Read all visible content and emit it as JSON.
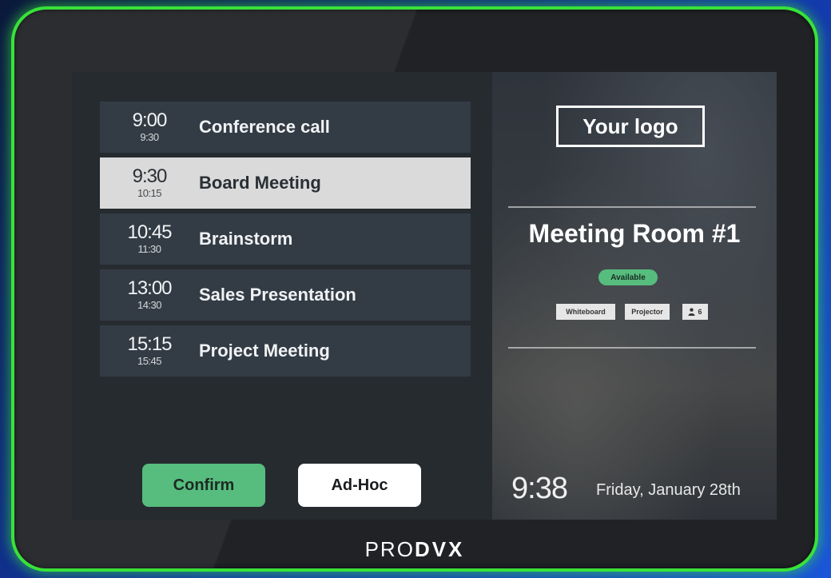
{
  "meetings": [
    {
      "start": "9:00",
      "end": "9:30",
      "title": "Conference call",
      "active": false
    },
    {
      "start": "9:30",
      "end": "10:15",
      "title": "Board Meeting",
      "active": true
    },
    {
      "start": "10:45",
      "end": "11:30",
      "title": "Brainstorm",
      "active": false
    },
    {
      "start": "13:00",
      "end": "14:30",
      "title": "Sales Presentation",
      "active": false
    },
    {
      "start": "15:15",
      "end": "15:45",
      "title": "Project Meeting",
      "active": false
    }
  ],
  "buttons": {
    "confirm": "Confirm",
    "adhoc": "Ad-Hoc"
  },
  "room": {
    "logo": "Your logo",
    "name": "Meeting Room #1",
    "status": "Available",
    "amenities": [
      "Whiteboard",
      "Projector"
    ],
    "capacity": "6"
  },
  "clock": {
    "time": "9:38",
    "date": "Friday, January 28th"
  },
  "brand": {
    "light": "PRO",
    "bold": "DVX"
  },
  "colors": {
    "bezel_glow": "#38e23a",
    "accent_green": "#56bd7e",
    "row_bg": "#333c45",
    "active_row_bg": "#dadada"
  },
  "icons": {
    "capacity": "person-icon"
  }
}
